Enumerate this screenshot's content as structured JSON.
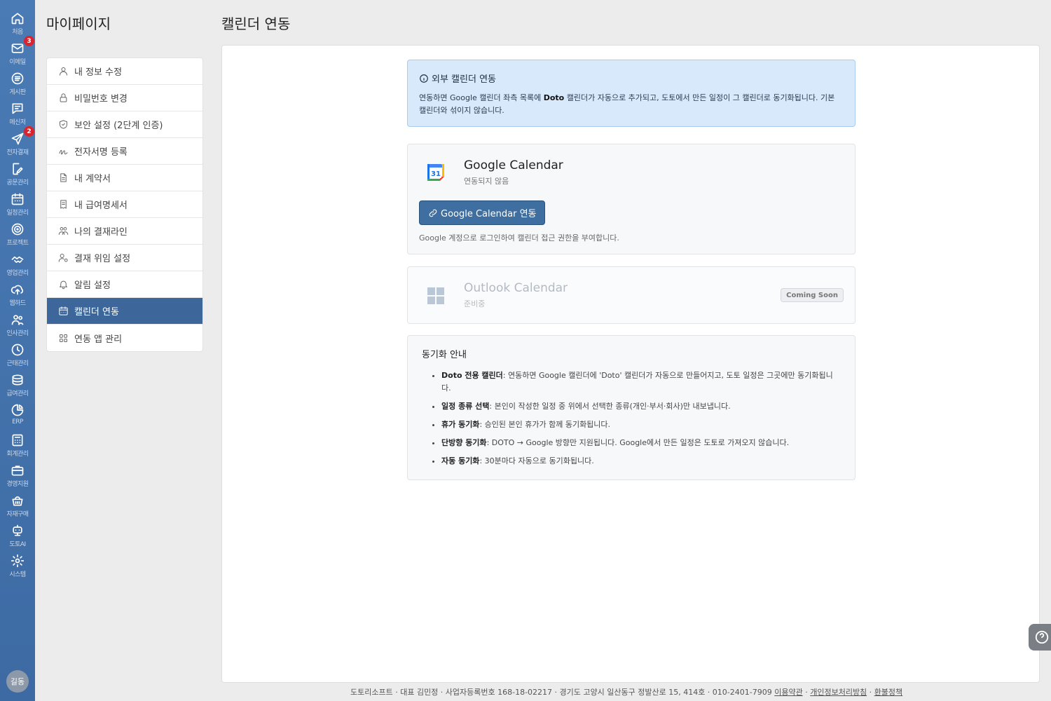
{
  "rail": {
    "items": [
      {
        "label": "처음",
        "icon": "home-icon"
      },
      {
        "label": "이메일",
        "icon": "mail-icon",
        "badge": "3"
      },
      {
        "label": "게시판",
        "icon": "board-icon"
      },
      {
        "label": "메신저",
        "icon": "messenger-icon"
      },
      {
        "label": "전자결재",
        "icon": "send-icon",
        "badge": "2"
      },
      {
        "label": "공문관리",
        "icon": "document-edit-icon"
      },
      {
        "label": "일정관리",
        "icon": "calendar-icon"
      },
      {
        "label": "프로젝트",
        "icon": "target-icon"
      },
      {
        "label": "영업관리",
        "icon": "handshake-icon"
      },
      {
        "label": "웹하드",
        "icon": "cloud-icon"
      },
      {
        "label": "인사관리",
        "icon": "people-icon"
      },
      {
        "label": "근태관리",
        "icon": "clock-icon"
      },
      {
        "label": "급여관리",
        "icon": "coins-icon"
      },
      {
        "label": "ERP",
        "icon": "pie-chart-icon"
      },
      {
        "label": "회계관리",
        "icon": "calculator-icon"
      },
      {
        "label": "경영지원",
        "icon": "briefcase-icon"
      },
      {
        "label": "자재구매",
        "icon": "basket-icon"
      },
      {
        "label": "도토AI",
        "icon": "robot-icon"
      },
      {
        "label": "시스템",
        "icon": "gear-icon"
      }
    ],
    "avatar": "길동"
  },
  "side": {
    "title": "마이페이지",
    "items": [
      {
        "label": "내 정보 수정",
        "icon": "user-icon"
      },
      {
        "label": "비밀번호 변경",
        "icon": "lock-icon"
      },
      {
        "label": "보안 설정 (2단계 인증)",
        "icon": "shield-icon"
      },
      {
        "label": "전자서명 등록",
        "icon": "signature-icon"
      },
      {
        "label": "내 계약서",
        "icon": "file-icon"
      },
      {
        "label": "내 급여명세서",
        "icon": "receipt-icon"
      },
      {
        "label": "나의 결재라인",
        "icon": "team-icon"
      },
      {
        "label": "결재 위임 설정",
        "icon": "user-delegate-icon"
      },
      {
        "label": "알림 설정",
        "icon": "bell-icon"
      },
      {
        "label": "캘린더 연동",
        "icon": "calendar-icon",
        "active": true
      },
      {
        "label": "연동 앱 관리",
        "icon": "apps-grid-icon"
      }
    ]
  },
  "main": {
    "title": "캘린더 연동",
    "info": {
      "heading": "외부 캘린더 연동",
      "text_before": "연동하면 Google 캘린더 좌측 목록에 ",
      "text_bold": "Doto",
      "text_after": " 캘린더가 자동으로 추가되고, 도토에서 만든 일정이 그 캘린더로 동기화됩니다. 기본 캘린더와 섞이지 않습니다."
    },
    "google": {
      "name": "Google Calendar",
      "status": "연동되지 않음",
      "button": "Google Calendar 연동",
      "desc": "Google 계정으로 로그인하여 캘린더 접근 권한을 부여합니다.",
      "icon_day": "31"
    },
    "outlook": {
      "name": "Outlook Calendar",
      "status": "준비중",
      "badge": "Coming Soon"
    },
    "guide": {
      "title": "동기화 안내",
      "items": [
        {
          "bold": "Doto 전용 캘린더",
          "text": ": 연동하면 Google 캘린더에 'Doto' 캘린더가 자동으로 만들어지고, 도토 일정은 그곳에만 동기화됩니다."
        },
        {
          "bold": "일정 종류 선택",
          "text": ": 본인이 작성한 일정 중 위에서 선택한 종류(개인·부서·회사)만 내보냅니다."
        },
        {
          "bold": "휴가 동기화",
          "text": ": 승인된 본인 휴가가 함께 동기화됩니다."
        },
        {
          "bold": "단방향 동기화",
          "text": ": DOTO → Google 방향만 지원됩니다. Google에서 만든 일정은 도토로 가져오지 않습니다."
        },
        {
          "bold": "자동 동기화",
          "text": ": 30분마다 자동으로 동기화됩니다."
        }
      ]
    }
  },
  "footer": {
    "text": "도토리소프트 · 대표 김민정 · 사업자등록번호 168-18-02217 · 경기도 고양시 일산동구 정발산로 15, 414호 · 010-2401-7909",
    "links": [
      "이용약관",
      "개인정보처리방침",
      "환불정책"
    ]
  },
  "colors": {
    "rail": "#4a7bb5",
    "active": "#3d679b",
    "info_bg": "#d8e9fb",
    "badge": "#d9232d"
  }
}
